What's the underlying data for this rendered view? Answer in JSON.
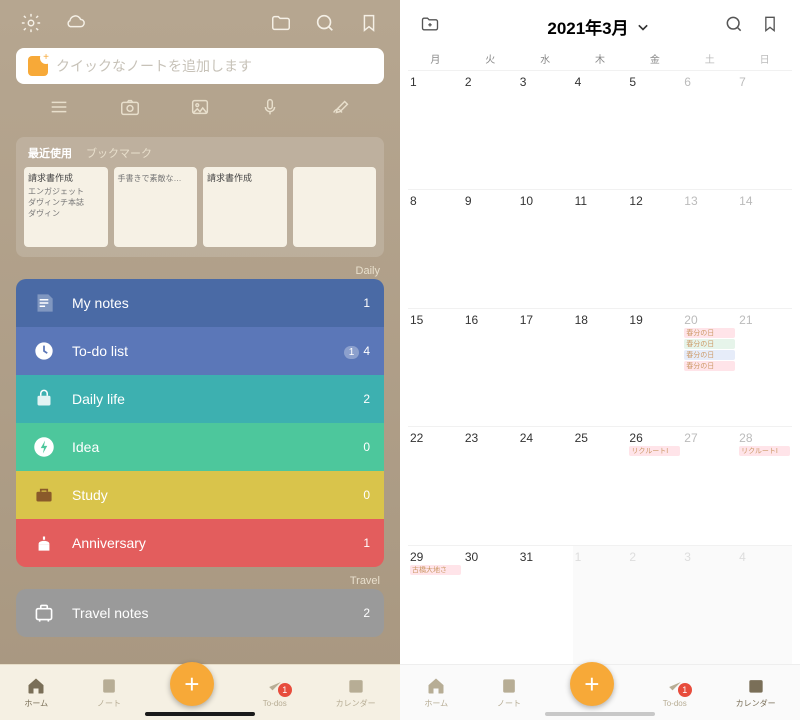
{
  "left": {
    "quicknote_placeholder": "クイックなノートを追加します",
    "recent_tab_active": "最近使用",
    "recent_tab_other": "ブックマーク",
    "recent_cards": [
      {
        "title": "請求書作成",
        "body": "エンガジェット\nダヴィンチ本誌\nダヴィン"
      },
      {
        "title": "",
        "body": "手書きで素敵な…"
      },
      {
        "title": "請求書作成",
        "body": ""
      },
      {
        "title": "",
        "body": ""
      }
    ],
    "section_daily": "Daily",
    "section_travel": "Travel",
    "cats": [
      {
        "label": "My notes",
        "count": "1",
        "color": "#4a6aa5",
        "icon": "notes"
      },
      {
        "label": "To-do list",
        "count": "4",
        "badge": "1",
        "color": "#5b77b8",
        "icon": "clock"
      },
      {
        "label": "Daily life",
        "count": "2",
        "color": "#3db0b0",
        "icon": "bag"
      },
      {
        "label": "Idea",
        "count": "0",
        "color": "#4dc79c",
        "icon": "bolt"
      },
      {
        "label": "Study",
        "count": "0",
        "color": "#d9c44b",
        "icon": "case"
      },
      {
        "label": "Anniversary",
        "count": "1",
        "color": "#e35d5d",
        "icon": "cake"
      }
    ],
    "travel_cat": {
      "label": "Travel notes",
      "count": "2",
      "color": "#9a9a9a"
    },
    "nav": [
      "ホーム",
      "ノート",
      "",
      "To-dos",
      "カレンダー"
    ],
    "nav_badge": "1"
  },
  "right": {
    "title": "2021年3月",
    "weekdays": [
      "月",
      "火",
      "水",
      "木",
      "金",
      "土",
      "日"
    ],
    "rows": [
      [
        {
          "d": "1"
        },
        {
          "d": "2"
        },
        {
          "d": "3"
        },
        {
          "d": "4"
        },
        {
          "d": "5"
        },
        {
          "d": "6",
          "we": 1
        },
        {
          "d": "7",
          "we": 1
        }
      ],
      [
        {
          "d": "8"
        },
        {
          "d": "9"
        },
        {
          "d": "10"
        },
        {
          "d": "11"
        },
        {
          "d": "12"
        },
        {
          "d": "13",
          "we": 1
        },
        {
          "d": "14",
          "we": 1
        }
      ],
      [
        {
          "d": "15"
        },
        {
          "d": "16"
        },
        {
          "d": "17"
        },
        {
          "d": "18"
        },
        {
          "d": "19"
        },
        {
          "d": "20",
          "we": 1,
          "ev": [
            "春分の日",
            "春分の日",
            "春分の日",
            "春分の日"
          ]
        },
        {
          "d": "21",
          "we": 1
        }
      ],
      [
        {
          "d": "22"
        },
        {
          "d": "23"
        },
        {
          "d": "24"
        },
        {
          "d": "25"
        },
        {
          "d": "26",
          "ev": [
            "リクルートI"
          ]
        },
        {
          "d": "27",
          "we": 1
        },
        {
          "d": "28",
          "we": 1,
          "ev": [
            "リクルートI"
          ]
        }
      ],
      [
        {
          "d": "29",
          "ev": [
            "古橋大地さ"
          ]
        },
        {
          "d": "30"
        },
        {
          "d": "31"
        },
        {
          "d": "1",
          "out": 1
        },
        {
          "d": "2",
          "out": 1
        },
        {
          "d": "3",
          "out": 1
        },
        {
          "d": "4",
          "out": 1
        }
      ]
    ],
    "nav": [
      "ホーム",
      "ノート",
      "",
      "To-dos",
      "カレンダー"
    ],
    "nav_badge": "1"
  }
}
